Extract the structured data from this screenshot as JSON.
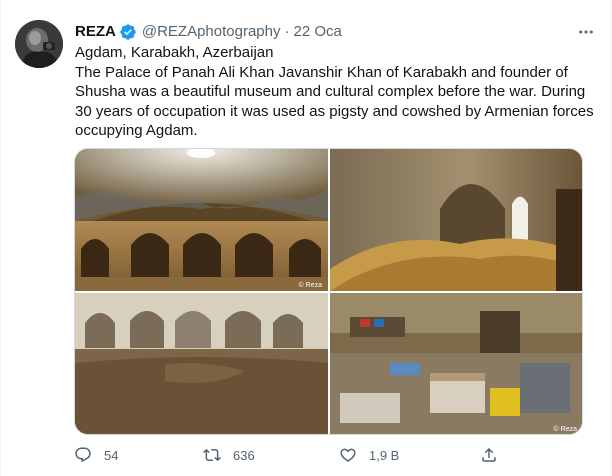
{
  "tweet": {
    "display_name": "REZA",
    "verified": true,
    "handle": "@REZAphotography",
    "separator": "·",
    "date": "22 Oca",
    "location_line": "Agdam, Karabakh, Azerbaijan",
    "text": "The Palace of Panah Ali Khan Javanshir Khan of Karabakh and founder of Shusha was a beautiful museum and cultural complex before the war. During 30 years of occupation it was used as pigsty and cowshed by Armenian forces occupying Agdam.",
    "more_icon": "ellipsis-icon"
  },
  "media": {
    "photos": [
      {
        "subject": "domed palace interior with arches",
        "credit": "© Reza"
      },
      {
        "subject": "arched room filled with hay",
        "credit": ""
      },
      {
        "subject": "arcaded hall with dirt floor",
        "credit": ""
      },
      {
        "subject": "abandoned room with debris and boxes",
        "credit": "© Reza"
      }
    ]
  },
  "actions": {
    "reply": {
      "icon": "reply-icon",
      "count": "54"
    },
    "retweet": {
      "icon": "retweet-icon",
      "count": "636"
    },
    "like": {
      "icon": "heart-icon",
      "count": "1,9 B"
    },
    "share": {
      "icon": "share-icon",
      "count": ""
    }
  },
  "colors": {
    "text_primary": "#0f1419",
    "text_secondary": "#536471",
    "verified_blue": "#1d9bf0",
    "border": "#cfd9de"
  }
}
